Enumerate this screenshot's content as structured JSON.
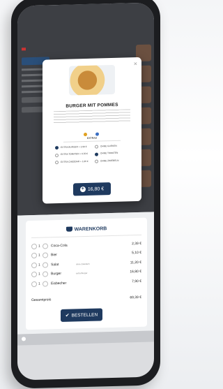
{
  "modal": {
    "close_icon": "×",
    "title": "BURGER MIT POMMES",
    "tags": [
      "",
      ""
    ],
    "extras_heading": "EXTRAS",
    "extras": [
      {
        "label": "EXTRA BURGER + 2,99 €",
        "selected": true
      },
      {
        "label": "OHNE GURKEN",
        "selected": false
      },
      {
        "label": "EXTRA TOMATEN + 0,50 €",
        "selected": false
      },
      {
        "label": "OHNE TOMATEN",
        "selected": true
      },
      {
        "label": "EXTRA CHEDDAR + 1,00 €",
        "selected": false
      },
      {
        "label": "OHNE ZWIEBELN",
        "selected": false
      }
    ],
    "price": "16,80 €"
  },
  "cart": {
    "title": "WARENKORB",
    "items": [
      {
        "qty": "1",
        "name": "Coca-Cola",
        "note": "",
        "price": "2,39 €"
      },
      {
        "qty": "1",
        "name": "Bier",
        "note": "",
        "price": "5,10 €"
      },
      {
        "qty": "1",
        "name": "Salat",
        "note": "ohne Zwiebeln",
        "price": "11,20 €"
      },
      {
        "qty": "1",
        "name": "Burger",
        "note": "extra Burger",
        "price": "16,80 €"
      },
      {
        "qty": "1",
        "name": "Eisbecher",
        "note": "",
        "price": "7,90 €"
      }
    ],
    "total_label": "Gesamtpreis",
    "total_value": "69,39 €",
    "order_button": "BESTELLEN"
  },
  "icons": [
    "close-icon",
    "plus-icon",
    "basket-icon",
    "check-icon"
  ]
}
